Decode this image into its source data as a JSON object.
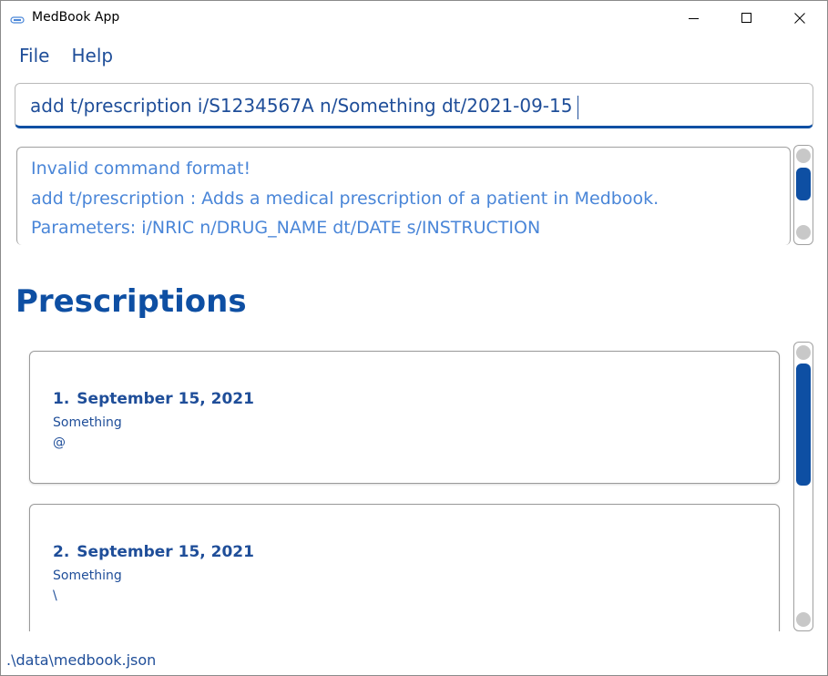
{
  "window": {
    "title": "MedBook App"
  },
  "menu": {
    "file": "File",
    "help": "Help"
  },
  "command": {
    "value": "add t/prescription i/S1234567A n/Something dt/2021-09-15"
  },
  "result": {
    "lines": [
      "Invalid command format!",
      "add t/prescription : Adds a medical prescription of a patient in Medbook.",
      "Parameters: i/NRIC n/DRUG_NAME dt/DATE s/INSTRUCTION"
    ]
  },
  "section": {
    "title": "Prescriptions"
  },
  "prescriptions": [
    {
      "index": "1.",
      "date": "September 15, 2021",
      "drug": "Something",
      "instruction": "@"
    },
    {
      "index": "2.",
      "date": "September 15, 2021",
      "drug": "Something",
      "instruction": "\\"
    }
  ],
  "status": {
    "path": ".\\data\\medbook.json"
  },
  "colors": {
    "accent": "#0e4fa3",
    "text": "#1f4e99",
    "result_text": "#4a86d8"
  }
}
